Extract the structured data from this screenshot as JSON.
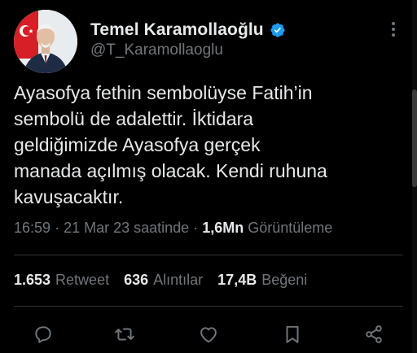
{
  "author": {
    "display_name": "Temel Karamollaoğlu",
    "handle": "@T_Karamollaoglu",
    "verified": true,
    "verified_color": "#1d9bf0"
  },
  "tweet": {
    "text": "Ayasofya fethin sembolüyse Fatih’in\nsembolü de adalettir. İktidara\ngeldiğimizde Ayasofya gerçek\nmanada açılmış olacak. Kendi ruhuna\nkavuşacaktır."
  },
  "meta": {
    "time": "16:59",
    "separator1": "·",
    "date": "21 Mar 23 saatinde",
    "separator2": "·",
    "views_count": "1,6Mn",
    "views_label": "Görüntüleme"
  },
  "stats": {
    "retweets": {
      "count": "1.653",
      "label": "Retweet"
    },
    "quotes": {
      "count": "636",
      "label": "Alıntılar"
    },
    "likes": {
      "count": "17,4B",
      "label": "Beğeni"
    }
  },
  "actions": {
    "icons": [
      "reply-icon",
      "retweet-icon",
      "like-icon",
      "bookmark-icon",
      "share-icon"
    ]
  },
  "colors": {
    "background": "#000000",
    "text_primary": "#e7e9ea",
    "text_secondary": "#71767b",
    "divider": "#2f3336"
  }
}
